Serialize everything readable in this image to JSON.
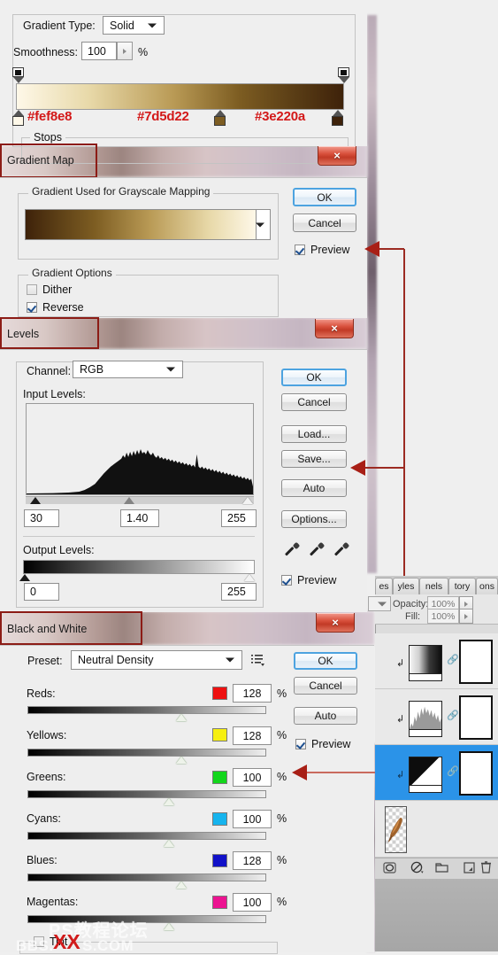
{
  "gradient_editor": {
    "gradient_type_label": "Gradient Type:",
    "gradient_type_value": "Solid",
    "smoothness_label": "Smoothness:",
    "smoothness_value": "100",
    "percent": "%",
    "stops_label": "Stops",
    "color_stops": [
      {
        "hex": "#fef8e8",
        "position": 0
      },
      {
        "hex": "#7d5d22",
        "position": 68
      },
      {
        "hex": "#3e220a",
        "position": 100
      }
    ]
  },
  "gradient_map": {
    "title": "Gradient Map",
    "close": "×",
    "group_label": "Gradient Used for Grayscale Mapping",
    "options_label": "Gradient Options",
    "dither_label": "Dither",
    "dither_checked": false,
    "reverse_label": "Reverse",
    "reverse_checked": true,
    "ok": "OK",
    "cancel": "Cancel",
    "preview_label": "Preview",
    "preview_checked": true
  },
  "levels": {
    "title": "Levels",
    "close": "×",
    "channel_label": "Channel:",
    "channel_value": "RGB",
    "input_levels_label": "Input Levels:",
    "input_shadow": "30",
    "input_gamma": "1.40",
    "input_highlight": "255",
    "output_levels_label": "Output Levels:",
    "output_black": "0",
    "output_white": "255",
    "ok": "OK",
    "cancel": "Cancel",
    "load": "Load...",
    "save": "Save...",
    "auto": "Auto",
    "options": "Options...",
    "preview_label": "Preview",
    "preview_checked": true
  },
  "black_and_white": {
    "title": "Black and White",
    "close": "×",
    "preset_label": "Preset:",
    "preset_value": "Neutral Density",
    "ok": "OK",
    "cancel": "Cancel",
    "auto": "Auto",
    "preview_label": "Preview",
    "preview_checked": true,
    "percent": "%",
    "tint_label": "Tint",
    "tint_checked": false,
    "sliders": [
      {
        "label": "Reds:",
        "value": "128",
        "swatch": "#ee1111",
        "thumb_pct": 51
      },
      {
        "label": "Yellows:",
        "value": "128",
        "swatch": "#f6ef10",
        "thumb_pct": 51
      },
      {
        "label": "Greens:",
        "value": "100",
        "swatch": "#12d61b",
        "thumb_pct": 45
      },
      {
        "label": "Cyans:",
        "value": "100",
        "swatch": "#16b4ee",
        "thumb_pct": 45
      },
      {
        "label": "Blues:",
        "value": "128",
        "swatch": "#1111c8",
        "thumb_pct": 51
      },
      {
        "label": "Magentas:",
        "value": "100",
        "swatch": "#ec1391",
        "thumb_pct": 45
      }
    ]
  },
  "layers_panel": {
    "tabs": [
      "es",
      "yles",
      "nels",
      "tory",
      "ons"
    ],
    "opacity_label": "Opacity:",
    "opacity_value": "100%",
    "fill_label": "Fill:",
    "fill_value": "100%",
    "layers": [
      {
        "kind": "gradient-map-layer",
        "selected": false
      },
      {
        "kind": "levels-layer",
        "selected": false
      },
      {
        "kind": "black-and-white-layer",
        "selected": true
      },
      {
        "kind": "image-layer",
        "selected": false
      }
    ]
  },
  "watermark": {
    "line1": "PS教程论坛",
    "line2_left": "BBS.",
    "line2_mark": "XX",
    "line2_right": "S.COM"
  }
}
